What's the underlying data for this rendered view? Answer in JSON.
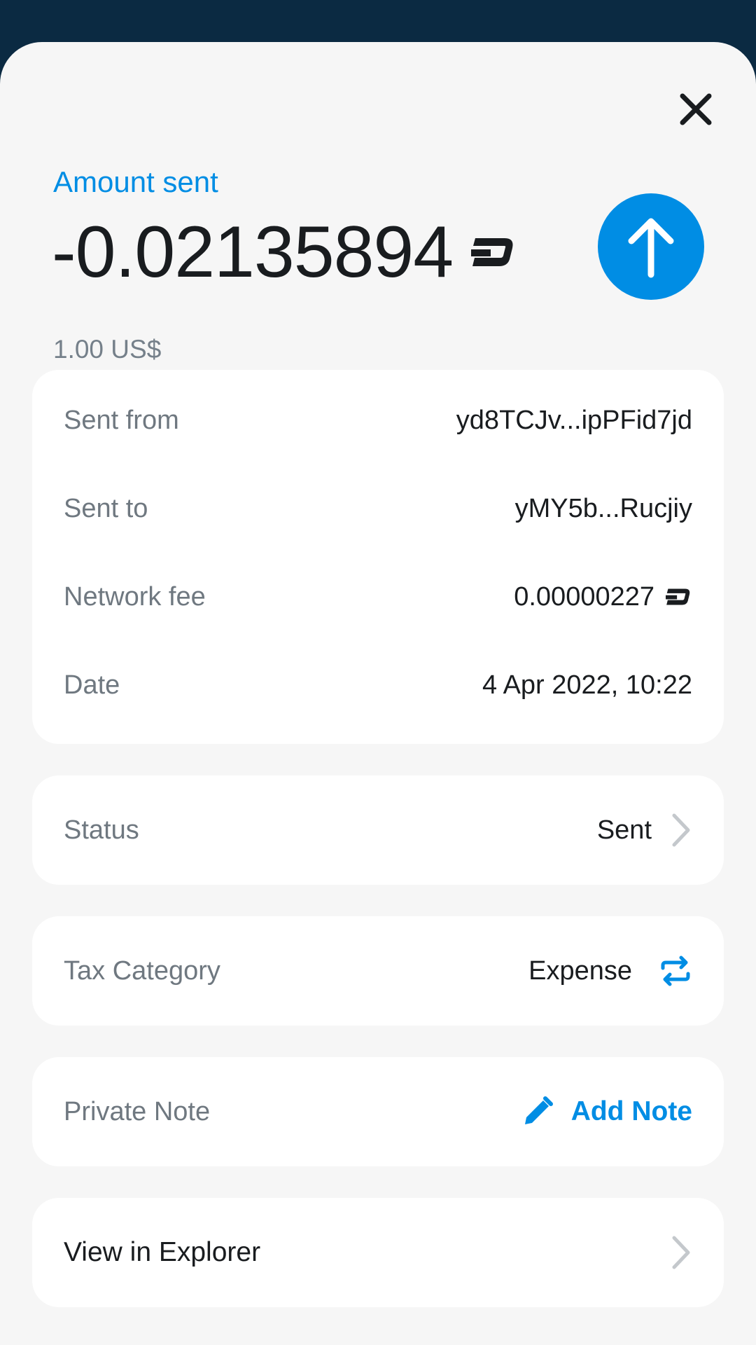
{
  "header": {
    "amount_label": "Amount sent",
    "amount_value": "-0.02135894",
    "fiat_value": "1.00 US$",
    "currency_icon": "dash-icon",
    "direction_icon": "arrow-up-icon",
    "close_icon": "close-icon"
  },
  "details": {
    "sent_from_label": "Sent from",
    "sent_from_value": "yd8TCJv...ipPFid7jd",
    "sent_to_label": "Sent to",
    "sent_to_value": "yMY5b...Rucjiy",
    "network_fee_label": "Network fee",
    "network_fee_value": "0.00000227",
    "date_label": "Date",
    "date_value": "4 Apr 2022, 10:22"
  },
  "status": {
    "label": "Status",
    "value": "Sent"
  },
  "tax": {
    "label": "Tax Category",
    "value": "Expense",
    "icon": "swap-icon"
  },
  "note": {
    "label": "Private Note",
    "action": "Add Note",
    "icon": "pencil-icon"
  },
  "explorer": {
    "label": "View in Explorer"
  },
  "colors": {
    "accent": "#008de4",
    "header_bg": "#0b2a42",
    "sheet_bg": "#f6f6f6",
    "card_bg": "#ffffff",
    "text_primary": "#191c1f",
    "text_secondary": "#6f7880"
  }
}
